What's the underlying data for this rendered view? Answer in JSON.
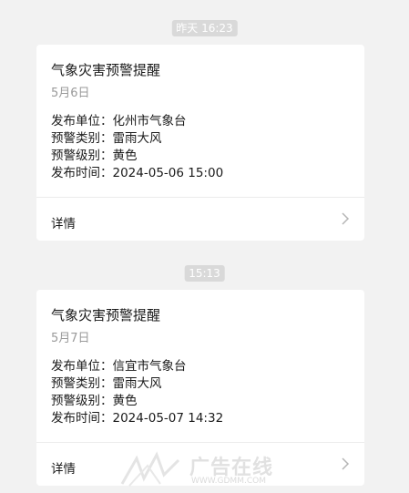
{
  "messages": [
    {
      "time": "昨天 16:23",
      "title": "气象灾害预警提醒",
      "date": "5月6日",
      "fields": [
        {
          "label": "发布单位：",
          "value": "化州市气象台"
        },
        {
          "label": "预警类别：",
          "value": "雷雨大风"
        },
        {
          "label": "预警级别：",
          "value": "黄色"
        },
        {
          "label": "发布时间：",
          "value": "2024-05-06 15:00"
        }
      ],
      "detail_label": "详情"
    },
    {
      "time": "15:13",
      "title": "气象灾害预警提醒",
      "date": "5月7日",
      "fields": [
        {
          "label": "发布单位：",
          "value": "信宜市气象台"
        },
        {
          "label": "预警类别：",
          "value": "雷雨大风"
        },
        {
          "label": "预警级别：",
          "value": "黄色"
        },
        {
          "label": "发布时间：",
          "value": "2024-05-07 14:32"
        }
      ],
      "detail_label": "详情"
    }
  ],
  "watermark": {
    "text": "广告在线",
    "url": "WWW.GDMM.COM"
  },
  "icons": {
    "chevron": "chevron-right-icon"
  }
}
